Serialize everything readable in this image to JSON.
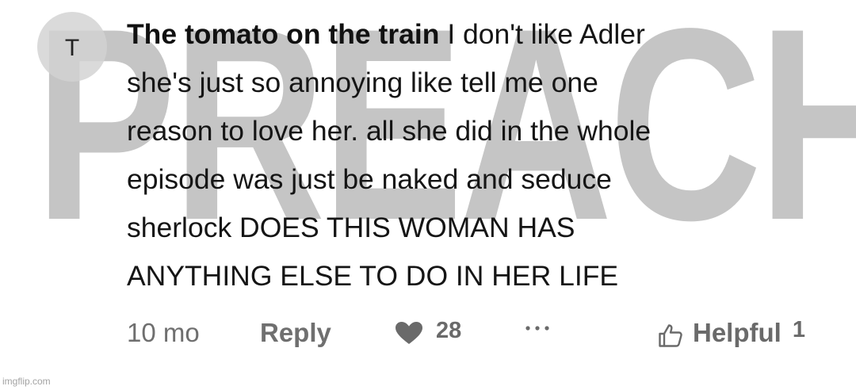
{
  "watermark": {
    "text": "PREACH."
  },
  "comment": {
    "avatar_letter": "T",
    "author": "The tomato on the train",
    "lines": [
      "I don't like Adler",
      "she's just so annoying like tell me one",
      "reason to love her. all she did in the whole",
      "episode was just be naked and seduce",
      "sherlock DOES THIS WOMAN HAS",
      "ANYTHING ELSE TO DO IN HER LIFE"
    ]
  },
  "actions": {
    "timestamp": "10 mo",
    "reply_label": "Reply",
    "like_count": "28",
    "helpful_label": "Helpful",
    "helpful_count": "1"
  },
  "icons": {
    "like": "heart-icon",
    "more": "more-dots-icon",
    "helpful": "thumbs-up-icon"
  },
  "credit": "imgflip.com",
  "colors": {
    "watermark": "#c5c5c5",
    "text": "#151515",
    "muted": "#6f6f6f"
  }
}
